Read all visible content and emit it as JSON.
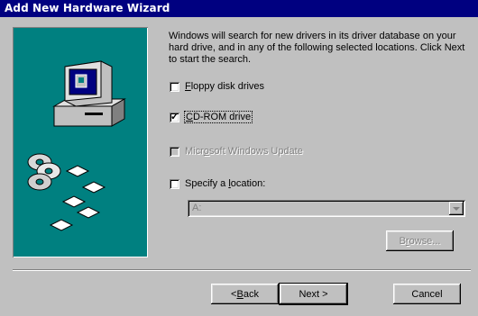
{
  "window": {
    "title": "Add New Hardware Wizard"
  },
  "intro_text": "Windows will search for new drivers in its driver database on your hard drive, and in any of the following selected locations. Click Next to start the search.",
  "options": [
    {
      "pre": "",
      "key": "F",
      "post": "loppy disk drives",
      "checked": false,
      "enabled": true
    },
    {
      "pre": "",
      "key": "C",
      "post": "D-ROM drive",
      "checked": true,
      "enabled": true
    },
    {
      "pre": "Micr",
      "key": "o",
      "post": "soft Windows Update",
      "checked": false,
      "enabled": false
    },
    {
      "pre": "Specify a ",
      "key": "l",
      "post": "ocation:",
      "checked": false,
      "enabled": true
    }
  ],
  "location_combo": {
    "value": "A:"
  },
  "browse_button": {
    "pre": "B",
    "key": "r",
    "post": "owse..."
  },
  "back_button": {
    "pre": "< ",
    "key": "B",
    "post": "ack"
  },
  "next_button": {
    "label": "Next >"
  },
  "cancel_button": {
    "label": "Cancel"
  },
  "colors": {
    "titlebar": "#000080",
    "panel": "#008080",
    "face": "#c0c0c0"
  },
  "icons": [
    "computer-icon",
    "cd-rom-icon",
    "floppy-disk-icon"
  ]
}
